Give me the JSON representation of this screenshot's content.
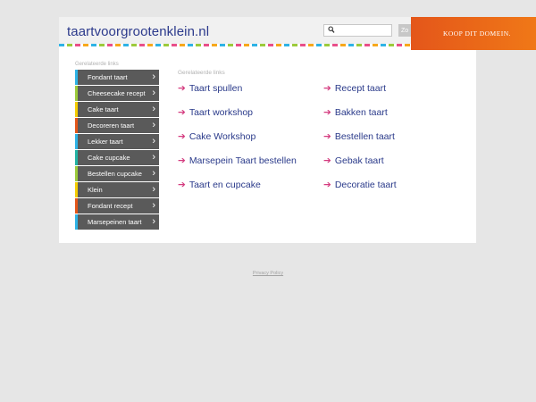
{
  "header": {
    "domain_title": "taartvoorgrootenklein.nl",
    "search_placeholder": "",
    "search_button_label": "Zo",
    "buy_banner_label": "KOOP DIT DOMEIN."
  },
  "sidebar": {
    "heading": "Gerelateerde links",
    "items": [
      {
        "label": "Fondant taart",
        "accent": "#2eb3e6"
      },
      {
        "label": "Cheesecake recept",
        "accent": "#9ccb3b"
      },
      {
        "label": "Cake taart",
        "accent": "#f5cd00"
      },
      {
        "label": "Decoreren taart",
        "accent": "#e4561a"
      },
      {
        "label": "Lekker taart",
        "accent": "#2eb3e6"
      },
      {
        "label": "Cake cupcake",
        "accent": "#22b3a4"
      },
      {
        "label": "Bestellen cupcake",
        "accent": "#9ccb3b"
      },
      {
        "label": "Klein",
        "accent": "#f5cd00"
      },
      {
        "label": "Fondant recept",
        "accent": "#e4561a"
      },
      {
        "label": "Marsepeinen taart",
        "accent": "#2eb3e6"
      }
    ]
  },
  "main": {
    "heading": "Gerelateerde links",
    "left_links": [
      "Taart spullen",
      "Taart workshop",
      "Cake Workshop",
      "Marsepein Taart bestellen",
      "Taart en cupcake"
    ],
    "right_links": [
      "Recept taart",
      "Bakken taart",
      "Bestellen taart",
      "Gebak taart",
      "Decoratie taart"
    ],
    "arrow_glyph": "➔"
  },
  "footer": {
    "privacy_label": "Privacy Policy"
  },
  "colors": {
    "page_bg": "#e6e6e6",
    "title_color": "#2c3a8c",
    "arrow_color": "#d43b7f",
    "sidebar_bg": "#5a5a5a",
    "banner_orange": "#f07817"
  }
}
